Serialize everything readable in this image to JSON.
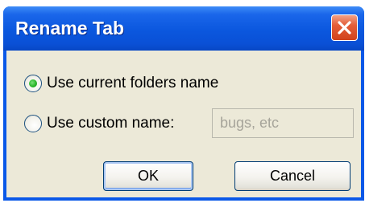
{
  "window": {
    "title": "Rename Tab"
  },
  "options": {
    "current_name_label": "Use current folders name",
    "current_name_selected": true,
    "custom_name_label": "Use custom name:",
    "custom_name_selected": false
  },
  "custom_name_input": {
    "placeholder": "bugs, etc",
    "value": ""
  },
  "buttons": {
    "ok_label": "OK",
    "cancel_label": "Cancel"
  },
  "colors": {
    "titlebar": "#0a58e8",
    "dialog_face": "#ece9d8",
    "close_button": "#e45e38",
    "radio_selected_dot": "#2bb62b",
    "button_border": "#003c74"
  },
  "icons": {
    "close": "close-icon"
  }
}
